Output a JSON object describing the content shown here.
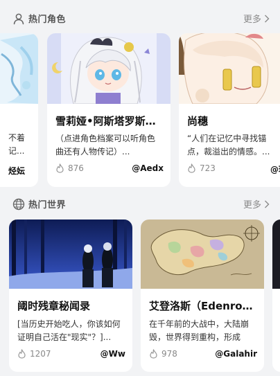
{
  "hot_characters": {
    "title": "热门角色",
    "more_label": "更多",
    "icon": "user-icon",
    "left_partial": {
      "desc_line1": "不着",
      "desc_line2": "记...",
      "author": "烃妘"
    },
    "cards": [
      {
        "title": "雪莉娅•阿斯塔罗斯…",
        "desc": "（点进角色档案可以听角色曲还有人物传记）...",
        "likes": "876",
        "author": "@Aedx"
      },
      {
        "title": "尚穗",
        "desc": "“人们在记忆中寻找锚点，裁溢出的情感。...",
        "likes": "723",
        "author": "@珺"
      }
    ]
  },
  "hot_worlds": {
    "title": "热门世界",
    "more_label": "更多",
    "icon": "globe-icon",
    "cards": [
      {
        "title": "阈时残章秘闻录",
        "desc": "[当历史开始吃人，你该如何证明自己活在\"现实\"？]...",
        "likes": "1207",
        "author": "@Ww"
      },
      {
        "title": "艾登洛斯（Edenros…",
        "desc": "在千年前的大战中，大陆崩毁，世界得到重构，形成了...",
        "likes": "978",
        "author": "@Galahir"
      }
    ]
  },
  "colors": {
    "background": "#f2f3f5",
    "card": "#ffffff",
    "muted": "#888888"
  }
}
